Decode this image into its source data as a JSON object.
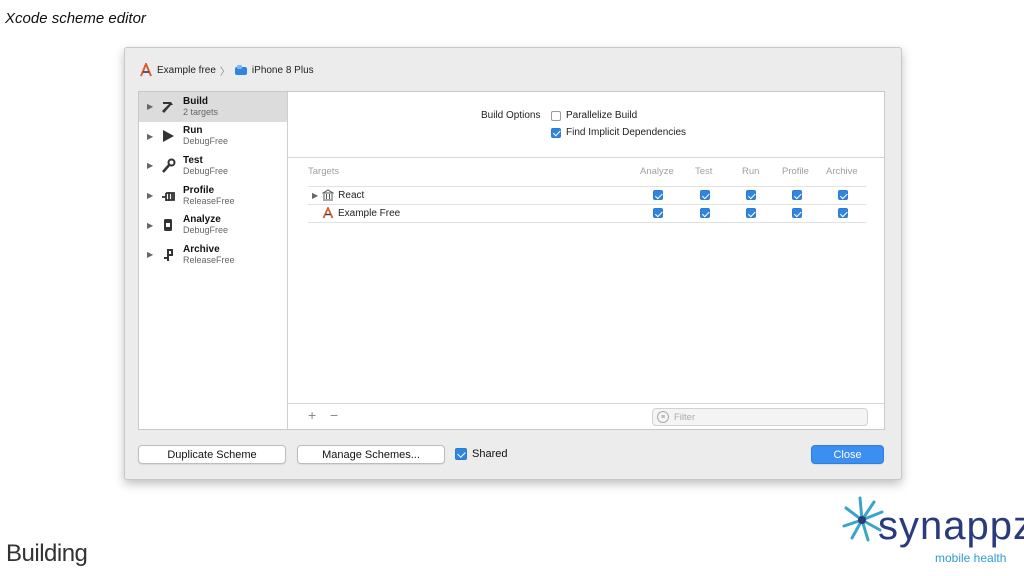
{
  "slide": {
    "title": "Xcode scheme editor",
    "footer": "Building"
  },
  "logo": {
    "word": "synappz",
    "tagline": "mobile health",
    "colors": {
      "word": "#2a3b7d",
      "accent": "#2d9bd3",
      "star": "#3aa5c8"
    }
  },
  "breadcrumb": {
    "scheme": "Example free",
    "separator": "〉",
    "device": "iPhone 8 Plus"
  },
  "sidebar": {
    "actions": [
      {
        "name": "Build",
        "sub": "2 targets",
        "icon": "hammer-icon",
        "selected": true
      },
      {
        "name": "Run",
        "sub": "DebugFree",
        "icon": "play-icon"
      },
      {
        "name": "Test",
        "sub": "DebugFree",
        "icon": "wrench-icon"
      },
      {
        "name": "Profile",
        "sub": "ReleaseFree",
        "icon": "profile-icon"
      },
      {
        "name": "Analyze",
        "sub": "DebugFree",
        "icon": "analyze-icon"
      },
      {
        "name": "Archive",
        "sub": "ReleaseFree",
        "icon": "archive-icon"
      }
    ]
  },
  "build_options": {
    "label": "Build Options",
    "parallelize": {
      "label": "Parallelize Build",
      "checked": false
    },
    "implicit": {
      "label": "Find Implicit Dependencies",
      "checked": true
    }
  },
  "targets": {
    "header": "Targets",
    "columns": [
      "Analyze",
      "Test",
      "Run",
      "Profile",
      "Archive"
    ],
    "rows": [
      {
        "name": "React",
        "icon": "library-icon",
        "checks": [
          true,
          true,
          true,
          true,
          true
        ]
      },
      {
        "name": "Example Free",
        "icon": "app-icon",
        "checks": [
          true,
          true,
          true,
          true,
          true
        ]
      }
    ],
    "add_label": "+",
    "remove_label": "−",
    "filter_placeholder": "Filter"
  },
  "footer": {
    "duplicate": "Duplicate Scheme",
    "manage": "Manage Schemes...",
    "shared": {
      "label": "Shared",
      "checked": true
    },
    "close": "Close"
  }
}
